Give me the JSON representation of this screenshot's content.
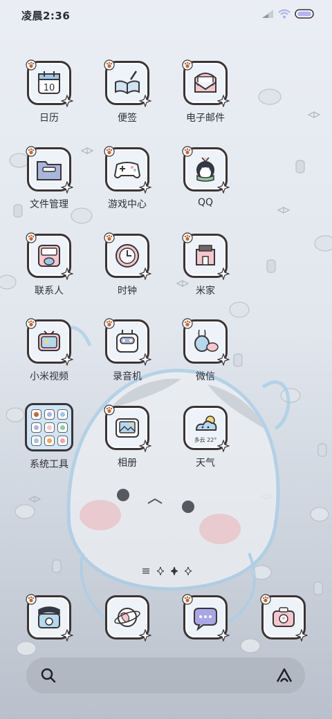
{
  "status_bar": {
    "time": "凌晨2:36",
    "icons": [
      "signal-icon",
      "wifi-icon",
      "battery-icon"
    ]
  },
  "apps": [
    {
      "label": "日历",
      "icon": "calendar-icon",
      "calendar_date": "10"
    },
    {
      "label": "便签",
      "icon": "notes-icon"
    },
    {
      "label": "电子邮件",
      "icon": "email-icon"
    },
    {
      "label": "文件管理",
      "icon": "file-manager-icon"
    },
    {
      "label": "游戏中心",
      "icon": "game-center-icon"
    },
    {
      "label": "QQ",
      "icon": "qq-icon"
    },
    {
      "label": "联系人",
      "icon": "contacts-icon"
    },
    {
      "label": "时钟",
      "icon": "clock-icon"
    },
    {
      "label": "米家",
      "icon": "mijia-icon"
    },
    {
      "label": "小米视频",
      "icon": "video-icon"
    },
    {
      "label": "录音机",
      "icon": "recorder-icon"
    },
    {
      "label": "微信",
      "icon": "wechat-icon"
    },
    {
      "label": "系统工具",
      "icon": "folder-icon"
    },
    {
      "label": "相册",
      "icon": "gallery-icon"
    },
    {
      "label": "天气",
      "icon": "weather-icon",
      "weather_text": "多云 22°"
    }
  ],
  "dock": [
    {
      "icon": "camera-icon"
    },
    {
      "icon": "browser-icon"
    },
    {
      "icon": "messages-icon"
    },
    {
      "icon": "camera-2-icon"
    }
  ],
  "colors": {
    "outline": "#3a3436",
    "icon_fill": "#eef3f9",
    "folder_fill": "#cfe6f7",
    "accent_blue": "#aed6f1",
    "accent_pink": "#f5c6d0"
  }
}
